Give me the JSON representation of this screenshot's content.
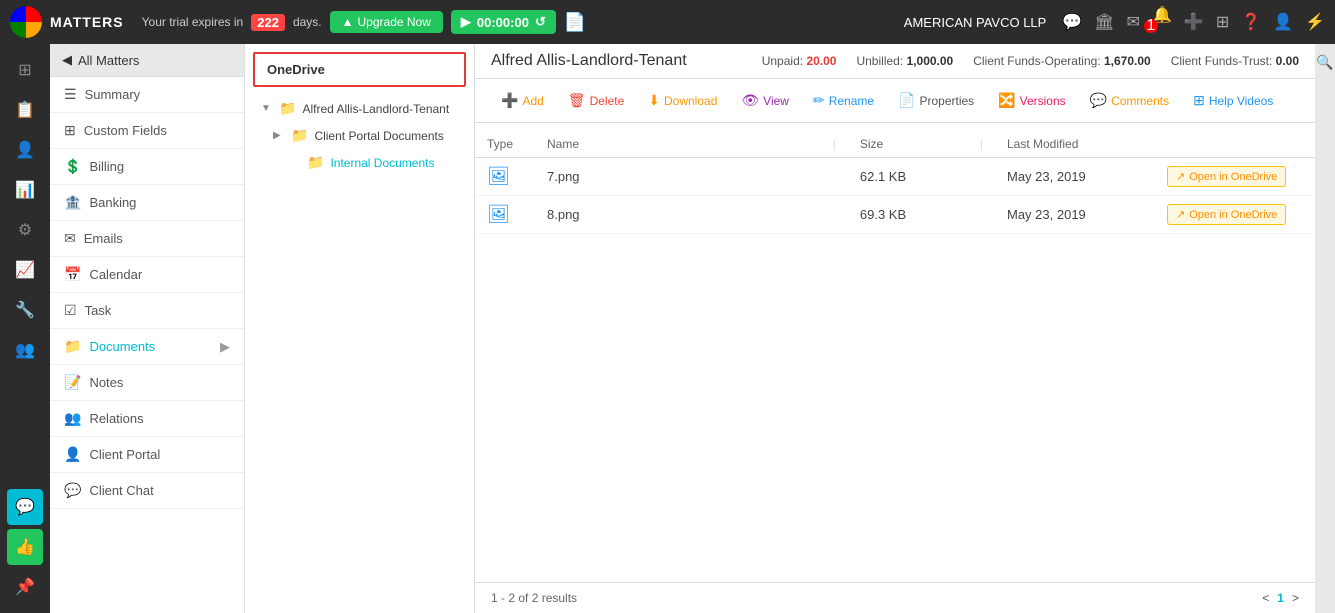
{
  "app": {
    "title": "MATTERS",
    "trial_text": "Your trial expires in",
    "trial_days": "222",
    "trial_days_suffix": "days.",
    "upgrade_btn": "Upgrade Now",
    "timer": "00:00:00",
    "client_name": "AMERICAN PAVCO LLP"
  },
  "matter": {
    "title": "Alfred Allis-Landlord-Tenant",
    "unpaid_label": "Unpaid:",
    "unpaid_value": "20.00",
    "unbilled_label": "Unbilled:",
    "unbilled_value": "1,000.00",
    "client_funds_op_label": "Client Funds-Operating:",
    "client_funds_op_value": "1,670.00",
    "client_funds_trust_label": "Client Funds-Trust:",
    "client_funds_trust_value": "0.00"
  },
  "toolbar": {
    "add": "Add",
    "delete": "Delete",
    "download": "Download",
    "view": "View",
    "rename": "Rename",
    "properties": "Properties",
    "versions": "Versions",
    "comments": "Comments",
    "help_videos": "Help Videos"
  },
  "left_menu": {
    "all_matters": "All Matters",
    "items": [
      {
        "id": "summary",
        "label": "Summary",
        "icon": "☰"
      },
      {
        "id": "custom-fields",
        "label": "Custom Fields",
        "icon": "⊞"
      },
      {
        "id": "billing",
        "label": "Billing",
        "icon": "💲"
      },
      {
        "id": "banking",
        "label": "Banking",
        "icon": "🏦"
      },
      {
        "id": "emails",
        "label": "Emails",
        "icon": "✉"
      },
      {
        "id": "calendar",
        "label": "Calendar",
        "icon": "📅"
      },
      {
        "id": "task",
        "label": "Task",
        "icon": "☑"
      },
      {
        "id": "documents",
        "label": "Documents",
        "icon": "📁",
        "has_arrow": true
      },
      {
        "id": "notes",
        "label": "Notes",
        "icon": "📝"
      },
      {
        "id": "relations",
        "label": "Relations",
        "icon": "👥"
      },
      {
        "id": "client-portal",
        "label": "Client Portal",
        "icon": "👤"
      },
      {
        "id": "client-chat",
        "label": "Client Chat",
        "icon": "💬"
      }
    ]
  },
  "file_tree": {
    "header": "OneDrive",
    "items": [
      {
        "id": "root",
        "label": "Alfred Allis-Landlord-Tenant",
        "level": 0,
        "expanded": true,
        "is_folder": true
      },
      {
        "id": "client-portal",
        "label": "Client Portal Documents",
        "level": 1,
        "expanded": true,
        "is_folder": true
      },
      {
        "id": "internal",
        "label": "Internal Documents",
        "level": 2,
        "expanded": false,
        "is_folder": true,
        "active": true
      }
    ]
  },
  "file_table": {
    "columns": [
      "Type",
      "Name",
      "Size",
      "Last Modified",
      ""
    ],
    "rows": [
      {
        "id": 1,
        "type_icon": "image",
        "name": "7.png",
        "size": "62.1 KB",
        "last_modified": "May 23, 2019",
        "action": "Open in OneDrive"
      },
      {
        "id": 2,
        "type_icon": "image",
        "name": "8.png",
        "size": "69.3 KB",
        "last_modified": "May 23, 2019",
        "action": "Open in OneDrive"
      }
    ],
    "footer_text": "1 - 2 of 2 results",
    "page_prev": "<",
    "page_num": "1",
    "page_next": ">"
  },
  "icon_sidebar": [
    {
      "id": "dashboard",
      "icon": "⊞",
      "active": false
    },
    {
      "id": "matters",
      "icon": "📋",
      "active": false
    },
    {
      "id": "contacts",
      "icon": "👤",
      "active": false
    },
    {
      "id": "reports",
      "icon": "📊",
      "active": false
    },
    {
      "id": "settings",
      "icon": "⚙",
      "active": false
    },
    {
      "id": "analytics",
      "icon": "📈",
      "active": false
    },
    {
      "id": "tools",
      "icon": "🔧",
      "active": false
    },
    {
      "id": "users",
      "icon": "👥",
      "active": false
    },
    {
      "id": "chat",
      "icon": "💬",
      "active": true
    },
    {
      "id": "thumbsup",
      "icon": "👍",
      "active": true
    },
    {
      "id": "pin",
      "icon": "📌",
      "active": false
    }
  ]
}
